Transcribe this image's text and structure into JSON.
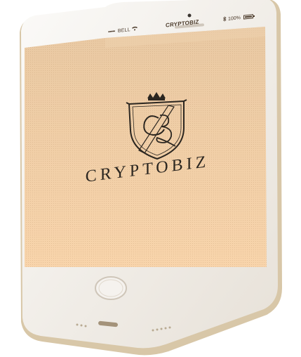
{
  "status_bar": {
    "signal_dots": "•••••",
    "carrier": "BELL",
    "app_name": "CRYPTOBIZ",
    "battery_text": "100%",
    "icons": [
      "signal-dots-icon",
      "wifi-icon",
      "bluetooth-icon",
      "battery-icon"
    ]
  },
  "splash": {
    "logo_monogram": "CB",
    "brand_name": "CRYPTOBIZ"
  },
  "colors": {
    "phone_frame": "#f3efe9",
    "phone_edge": "#d7c8b0",
    "screen_top": "#e9c9a3",
    "screen_bottom": "#f6d3aa",
    "text_dark": "#2b2620"
  }
}
